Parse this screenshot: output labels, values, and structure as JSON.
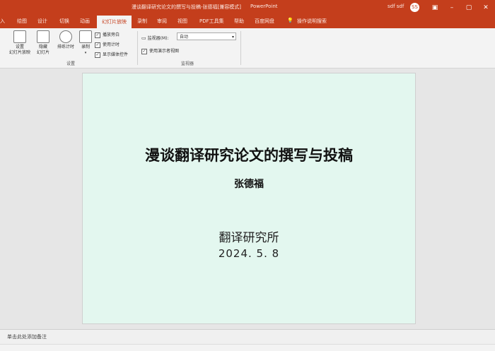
{
  "window": {
    "title": "漫谈翻译研究论文的撰写与投稿-张德福[兼容模式]",
    "app_name": "PowerPoint",
    "user": "sdf sdf",
    "avatar": "SS"
  },
  "tabs": [
    {
      "label": "入"
    },
    {
      "label": "绘图"
    },
    {
      "label": "设计"
    },
    {
      "label": "切换"
    },
    {
      "label": "动画"
    },
    {
      "label": "幻灯片放映"
    },
    {
      "label": "录制"
    },
    {
      "label": "审阅"
    },
    {
      "label": "视图"
    },
    {
      "label": "PDF工具集"
    },
    {
      "label": "帮助"
    },
    {
      "label": "百度网盘"
    },
    {
      "label": "操作说明搜索"
    }
  ],
  "ribbon": {
    "setup_slideshow": "设置\n幻灯片放映",
    "hide_slide": "隐藏\n幻灯片",
    "rehearse_timings": "排练计时",
    "record": "录制",
    "check_narration": "播放旁白",
    "check_timings": "使用计时",
    "check_media": "显示媒体控件",
    "group_setup": "设置",
    "monitor_label": "监视器(M):",
    "monitor_value": "自动",
    "presenter_view": "使用演示者视图",
    "group_monitors": "监视器"
  },
  "slide": {
    "title": "漫谈翻译研究论文的撰写与投稿",
    "author": "张德福",
    "institute": "翻译研究所",
    "date": "2024. 5. 8"
  },
  "notes": {
    "placeholder": "单击此处添加备注"
  }
}
